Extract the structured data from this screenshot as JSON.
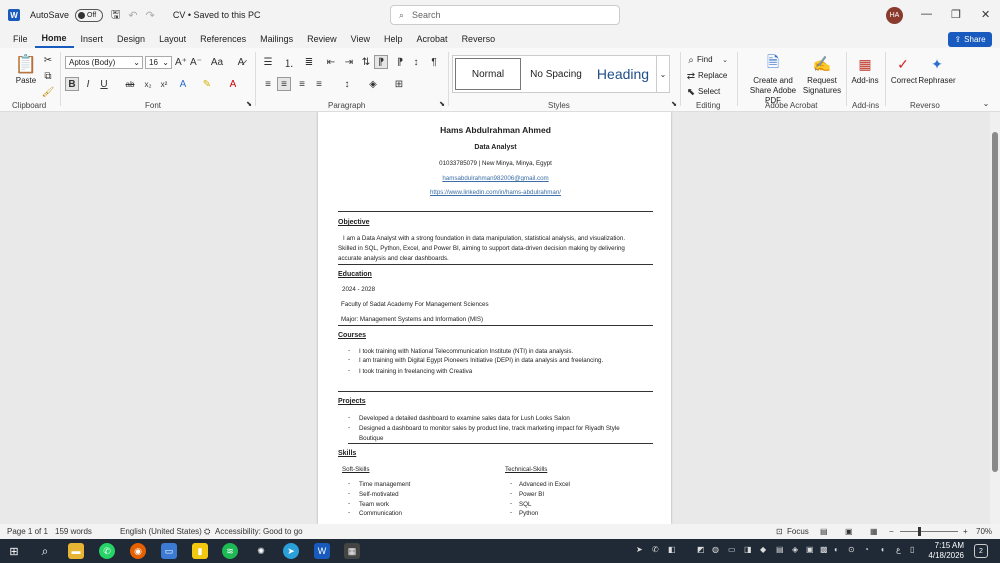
{
  "titlebar": {
    "autosave_label": "AutoSave",
    "autosave_state": "Off",
    "doc_title": "CV • Saved to this PC",
    "search_placeholder": "Search",
    "avatar_initials": "HA"
  },
  "menu": {
    "tabs": [
      "File",
      "Home",
      "Insert",
      "Design",
      "Layout",
      "References",
      "Mailings",
      "Review",
      "View",
      "Help",
      "Acrobat",
      "Reverso"
    ],
    "active": "Home",
    "share_label": "Share"
  },
  "ribbon": {
    "groups": {
      "clipboard": "Clipboard",
      "font": "Font",
      "paragraph": "Paragraph",
      "styles": "Styles",
      "editing": "Editing",
      "adobe": "Adobe Acrobat",
      "addins": "Add-ins",
      "reverso": "Reverso"
    },
    "paste_label": "Paste",
    "font_name": "Aptos (Body)",
    "font_size": "16",
    "styles": [
      "Normal",
      "No Spacing",
      "Heading"
    ],
    "find_label": "Find",
    "replace_label": "Replace",
    "select_label": "Select",
    "adobe_create_label": "Create and Share Adobe PDF",
    "adobe_request_label": "Request Signatures",
    "addins_label": "Add-ins",
    "correct_label": "Correct",
    "rephraser_label": "Rephraser"
  },
  "document": {
    "name": "Hams Abdulrahman Ahmed",
    "role": "Data Analyst",
    "contact": "01033785079 | New Minya, Minya, Egypt",
    "email": "hamsabdulrahman982006@gmail.com",
    "linkedin": "https://www.linkedin.com/in/hams-abdulrahman/",
    "objective_heading": "Objective",
    "objective_text_1": "I am a Data Analyst with a strong foundation in data manipulation, statistical analysis, and visualization.",
    "objective_text_2": "Skilled in SQL, Python, Excel, and Power BI, aiming to support data-driven decision making by delivering",
    "objective_text_3": "accurate analysis and clear dashboards.",
    "education_heading": "Education",
    "education_years": "2024 - 2028",
    "education_school": "Faculty of Sadat Academy For Management Sciences",
    "education_major": "Major: Management Systems and Information (MIS)",
    "courses_heading": "Courses",
    "courses": [
      "I took training with National Telecommunication Institute (NTI) in data analysis.",
      "I am training with Digital Egypt Pioneers Initiative (DEPI) in data analysis and freelancing.",
      "I took training in freelancing with Creativa"
    ],
    "projects_heading": "Projects",
    "projects": [
      "Developed a detailed dashboard to examine sales data for Lush Looks Salon",
      "Designed a dashboard to monitor sales by product line, track marketing impact for Riyadh Style",
      "Boutique"
    ],
    "skills_heading": "Skills",
    "soft_heading": "Soft-Skills",
    "tech_heading": "Technical-Skills",
    "soft_skills": [
      "Time management",
      "Self-motivated",
      "Team work",
      "Communication"
    ],
    "tech_skills": [
      "Advanced in Excel",
      "Power BI",
      "SQL",
      "Python"
    ],
    "bullet_char": "-"
  },
  "status": {
    "page": "Page 1 of 1",
    "words": "159 words",
    "language": "English (United States)",
    "accessibility": "Accessibility: Good to go",
    "focus": "Focus",
    "zoom": "70%"
  },
  "taskbar": {
    "clock_time": "7:15 AM",
    "clock_date": "4/18/2026",
    "notifications": "2"
  },
  "colors": {
    "word_blue": "#185abd",
    "taskbar_bg": "#202a36",
    "link_blue": "#3a6ea5"
  }
}
